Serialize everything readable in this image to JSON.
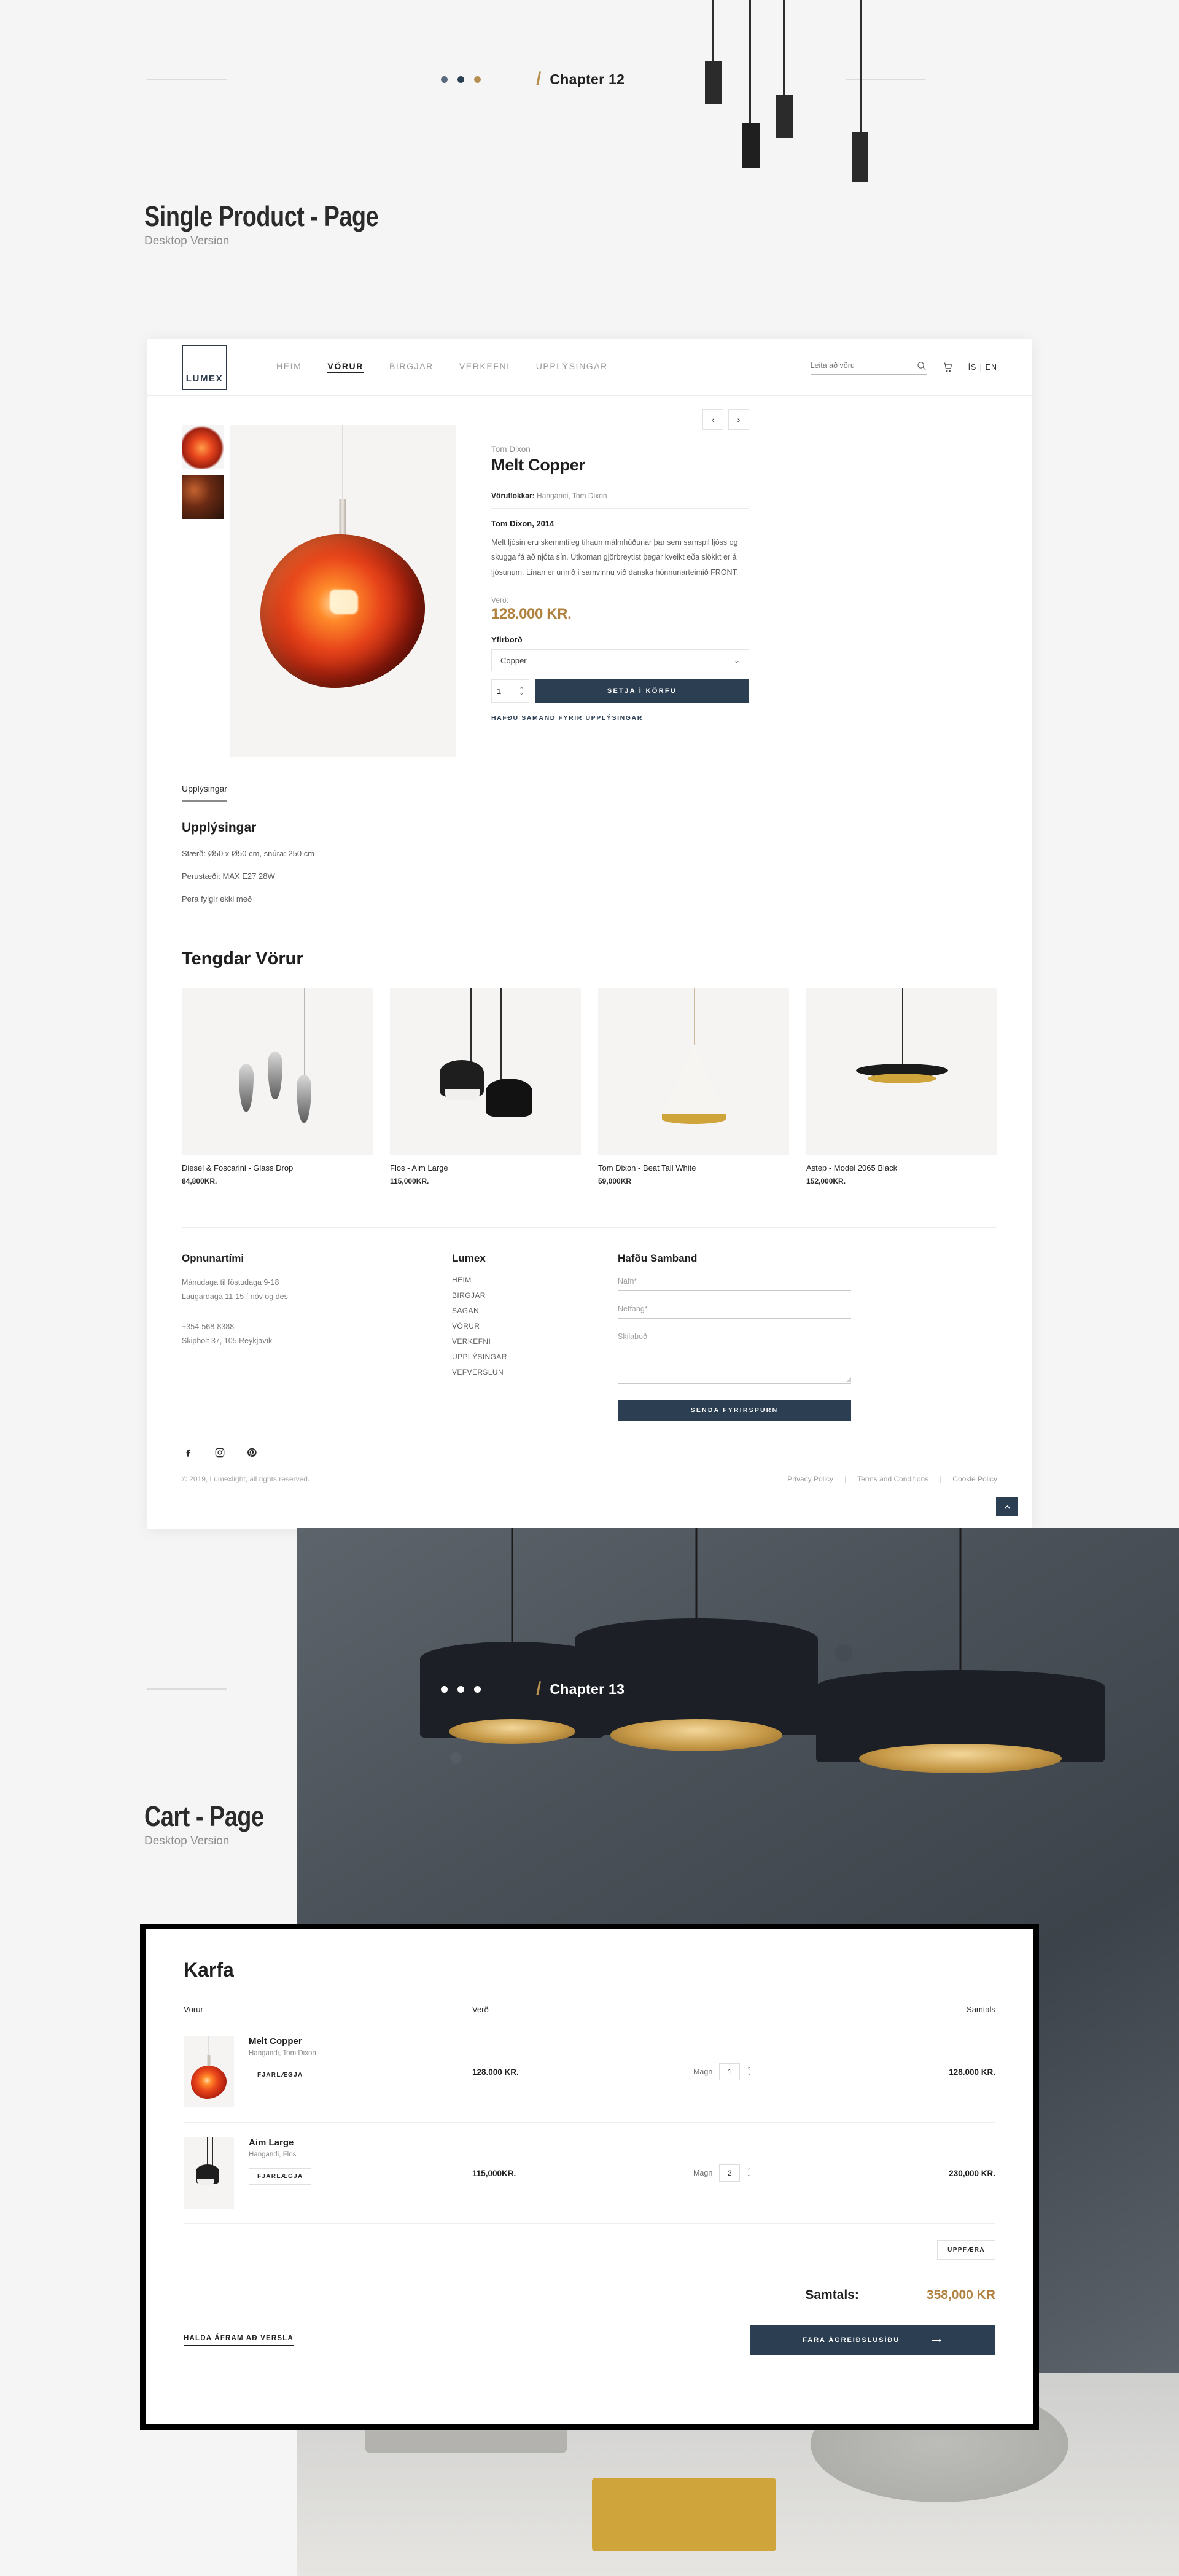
{
  "sections": [
    {
      "chapter": "Chapter 12",
      "title": "Single Product - Page",
      "subtitle": "Desktop Version",
      "dot_colors": [
        "#5b6b7d",
        "#2b3e52",
        "#b58f50"
      ]
    },
    {
      "chapter": "Chapter 13",
      "title": "Cart - Page",
      "subtitle": "Desktop Version",
      "dot_colors": [
        "#ffffff",
        "#ffffff",
        "#ffffff"
      ]
    }
  ],
  "colors": {
    "accent_gold": "#b0813f",
    "dark_navy": "#2b3e52",
    "slash_gold": "#b58f50"
  },
  "site": {
    "logo": "LUMEX",
    "nav": [
      {
        "label": "HEIM",
        "active": false
      },
      {
        "label": "VÖRUR",
        "active": true
      },
      {
        "label": "BIRGJAR",
        "active": false
      },
      {
        "label": "VERKEFNI",
        "active": false
      },
      {
        "label": "UPPLÝSINGAR",
        "active": false
      }
    ],
    "search_placeholder": "Leita að vöru",
    "search_value": "",
    "lang_primary": "ÍS",
    "lang_secondary": "EN",
    "icons": {
      "search": "search-icon",
      "cart": "cart-icon"
    }
  },
  "product": {
    "prev_label": "‹",
    "next_label": "›",
    "brand": "Tom Dixon",
    "title": "Melt Copper",
    "categories_label": "Vöruflokkar:",
    "categories_value": "Hangandi, Tom Dixon",
    "designer_year": "Tom Dixon, 2014",
    "description": "Melt ljósin eru skemmtileg tilraun málmhúðunar þar sem samspil ljóss og skugga fá að njóta sín. Útkoman gjörbreytist þegar kveikt eða slökkt er á ljósunum. Línan er unnið í samvinnu við danska hönnunarteimið FRONT.",
    "price_label": "Verð:",
    "price": "128.000 KR.",
    "option_label": "Yfirborð",
    "option_value": "Copper",
    "qty_value": "1",
    "add_to_cart": "SETJA Í KÖRFU",
    "contact_link": "HAFÐU SAMAND FYRIR UPPLÝSINGAR"
  },
  "tabs": {
    "active_tab": "Upplýsingar"
  },
  "info": {
    "heading": "Upplýsingar",
    "lines": [
      "Stærð: Ø50 x Ø50 cm, snúra: 250 cm",
      "Perustæði: MAX E27 28W",
      "Pera fylgir ekki með"
    ]
  },
  "related": {
    "heading": "Tengdar Vörur",
    "items": [
      {
        "name": "Diesel & Foscarini - Glass Drop",
        "price": "84,800KR."
      },
      {
        "name": "Flos - Aim Large",
        "price": "115,000KR."
      },
      {
        "name": "Tom Dixon - Beat Tall White",
        "price": "59,000KR"
      },
      {
        "name": "Astep - Model 2065 Black",
        "price": "152,000KR."
      }
    ]
  },
  "footer": {
    "hours_heading": "Opnunartími",
    "hours_line1": "Mánudaga til föstudaga 9-18",
    "hours_line2": "Laugardaga 11-15 í nóv og des",
    "phone": "+354-568-8388",
    "address": "Skipholt 37, 105 Reykjavík",
    "links_heading": "Lumex",
    "links": [
      "HEIM",
      "BIRGJAR",
      "SAGAN",
      "VÖRUR",
      "VERKEFNI",
      "UPPLÝSINGAR",
      "VEFVERSLUN"
    ],
    "form_heading": "Hafðu Samband",
    "field_name": "Nafn*",
    "field_email": "Netfang*",
    "field_message": "Skilaboð",
    "submit": "SENDA FYRIRSPURN",
    "socials": [
      "facebook-icon",
      "instagram-icon",
      "pinterest-icon"
    ],
    "copyright": "© 2019, Lumexlight, all rights reserved.",
    "legal": [
      "Privacy Policy",
      "Terms and Conditions",
      "Cookie Policy"
    ],
    "back_to_top": "back-to-top-icon"
  },
  "cart": {
    "heading": "Karfa",
    "columns": {
      "product": "Vörur",
      "price": "Verð",
      "total": "Samtals"
    },
    "qty_label": "Magn",
    "remove_label": "FJARLÆGJA",
    "items": [
      {
        "name": "Melt Copper",
        "category": "Hangandi, Tom Dixon",
        "price": "128.000 KR.",
        "qty": "1",
        "total": "128.000 KR."
      },
      {
        "name": "Aim Large",
        "category": "Hangandi, Flos",
        "price": "115,000KR.",
        "qty": "2",
        "total": "230,000 KR."
      }
    ],
    "update_label": "UPPFÆRA",
    "total_label": "Samtals:",
    "total_value": "358,000 KR",
    "continue_label": "HALDA ÁFRAM AÐ VERSLA",
    "checkout_label": "FARA ÁGREIÐSLUSÍÐU",
    "checkout_arrow": "⟶"
  }
}
